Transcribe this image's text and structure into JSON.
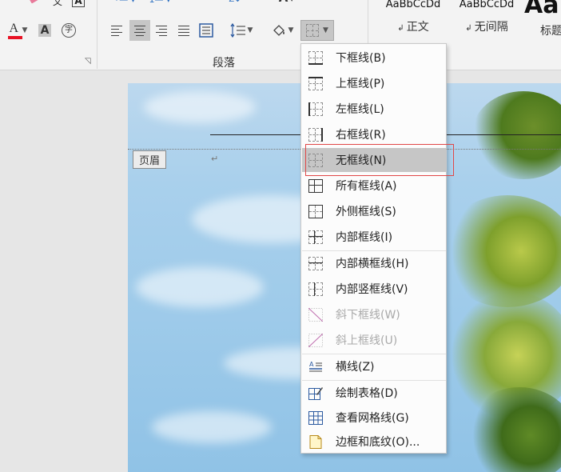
{
  "ribbon": {
    "group_label": "段落",
    "text_color_letter": "A",
    "font_char_shading_letter": "A",
    "enclose_char": "字",
    "styles": [
      {
        "sample": "AaBbCcDd",
        "name": "正文"
      },
      {
        "sample": "AaBbCcDd",
        "name": "无间隔"
      },
      {
        "sample": "Aa",
        "name": "标题"
      }
    ],
    "colors": {
      "accent_red": "#e81123",
      "selected": "#c6c6c6"
    }
  },
  "document": {
    "header_tag": "页眉",
    "paragraph_mark": "↵"
  },
  "menu": {
    "items": [
      {
        "label": "下框线(B)",
        "icon": "bottom-border-icon",
        "disabled": false,
        "highlighted": false
      },
      {
        "label": "上框线(P)",
        "icon": "top-border-icon",
        "disabled": false,
        "highlighted": false
      },
      {
        "label": "左框线(L)",
        "icon": "left-border-icon",
        "disabled": false,
        "highlighted": false
      },
      {
        "label": "右框线(R)",
        "icon": "right-border-icon",
        "disabled": false,
        "highlighted": false
      },
      {
        "label": "无框线(N)",
        "icon": "no-border-icon",
        "disabled": false,
        "highlighted": true
      },
      {
        "label": "所有框线(A)",
        "icon": "all-borders-icon",
        "disabled": false,
        "highlighted": false
      },
      {
        "label": "外侧框线(S)",
        "icon": "outside-borders-icon",
        "disabled": false,
        "highlighted": false
      },
      {
        "label": "内部框线(I)",
        "icon": "inside-borders-icon",
        "disabled": false,
        "highlighted": false
      },
      {
        "label": "内部横框线(H)",
        "icon": "inside-horizontal-border-icon",
        "disabled": false,
        "highlighted": false
      },
      {
        "label": "内部竖框线(V)",
        "icon": "inside-vertical-border-icon",
        "disabled": false,
        "highlighted": false
      },
      {
        "label": "斜下框线(W)",
        "icon": "diagonal-down-border-icon",
        "disabled": true,
        "highlighted": false
      },
      {
        "label": "斜上框线(U)",
        "icon": "diagonal-up-border-icon",
        "disabled": true,
        "highlighted": false
      },
      {
        "label": "横线(Z)",
        "icon": "horizontal-line-icon",
        "disabled": false,
        "highlighted": false
      },
      {
        "label": "绘制表格(D)",
        "icon": "draw-table-icon",
        "disabled": false,
        "highlighted": false
      },
      {
        "label": "查看网格线(G)",
        "icon": "view-gridlines-icon",
        "disabled": false,
        "highlighted": false
      },
      {
        "label": "边框和底纹(O)...",
        "icon": "borders-and-shading-icon",
        "disabled": false,
        "highlighted": false
      }
    ]
  }
}
